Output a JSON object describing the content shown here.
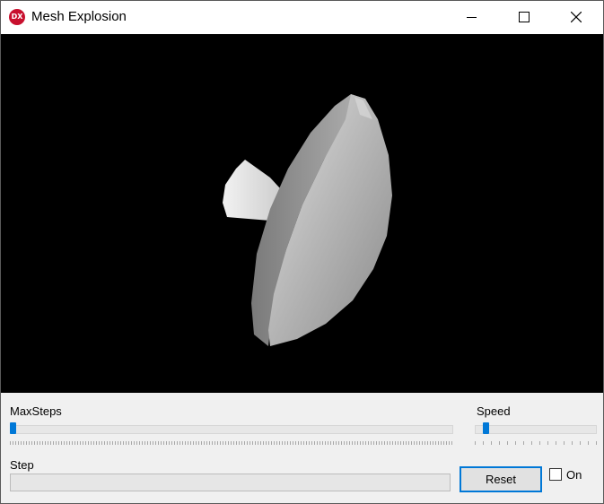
{
  "window": {
    "title": "Mesh Explosion",
    "icon_text": "DX",
    "icons": {
      "app": "directx-icon",
      "minimize": "minimize-icon",
      "maximize": "maximize-icon",
      "close": "close-icon"
    }
  },
  "viewport": {
    "background": "#000000",
    "content": "exploding-mesh-dish"
  },
  "controls": {
    "max_steps": {
      "label": "MaxSteps",
      "value_fraction": 0.0
    },
    "speed": {
      "label": "Speed",
      "value_fraction": 0.07
    },
    "step": {
      "label": "Step",
      "progress": 0.0
    },
    "reset_label": "Reset",
    "on_label": "On",
    "on_checked": false
  },
  "colors": {
    "accent": "#0078d7",
    "panel": "#f0f0f0"
  }
}
